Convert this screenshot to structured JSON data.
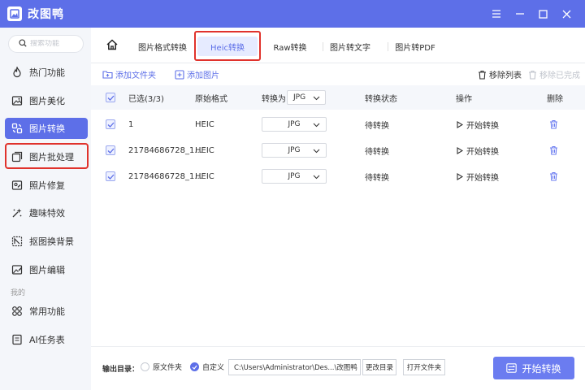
{
  "app": {
    "title": "改图鸭"
  },
  "window": {
    "menu_icon": "menu-icon",
    "minimize_icon": "minimize-icon",
    "maximize_icon": "maximize-icon",
    "close_icon": "close-icon"
  },
  "sidebar": {
    "search_placeholder": "搜索功能",
    "items": [
      {
        "label": "热门功能",
        "icon": "flame-icon"
      },
      {
        "label": "图片美化",
        "icon": "image-icon"
      },
      {
        "label": "图片转换",
        "icon": "convert-icon",
        "active": true
      },
      {
        "label": "图片批处理",
        "icon": "batch-icon"
      },
      {
        "label": "照片修复",
        "icon": "repair-icon"
      },
      {
        "label": "趣味特效",
        "icon": "sparkle-icon"
      },
      {
        "label": "抠图换背景",
        "icon": "cutout-icon"
      },
      {
        "label": "图片编辑",
        "icon": "edit-icon"
      }
    ],
    "section_mine": "我的",
    "mine_items": [
      {
        "label": "常用功能",
        "icon": "grid-icon"
      },
      {
        "label": "AI任务表",
        "icon": "task-icon"
      }
    ]
  },
  "tabs": [
    {
      "label": "图片格式转换"
    },
    {
      "label": "Heic转换",
      "active": true
    },
    {
      "label": "Raw转换"
    },
    {
      "label": "图片转文字"
    },
    {
      "label": "图片转PDF"
    }
  ],
  "toolbar": {
    "add_folder": "添加文件夹",
    "add_image": "添加图片",
    "remove_list": "移除列表",
    "remove_done": "移除已完成"
  },
  "table": {
    "headers": {
      "selected": "已选(3/3)",
      "original_format": "原始格式",
      "convert_to": "转换为",
      "convert_to_value": "JPG",
      "status": "转换状态",
      "operation": "操作",
      "delete": "删除"
    },
    "rows": [
      {
        "name": "1",
        "format": "HEIC",
        "target": "JPG",
        "status": "待转换",
        "action": "开始转换"
      },
      {
        "name": "21784686728_1...",
        "format": "HEIC",
        "target": "JPG",
        "status": "待转换",
        "action": "开始转换"
      },
      {
        "name": "21784686728_1...",
        "format": "HEIC",
        "target": "JPG",
        "status": "待转换",
        "action": "开始转换"
      }
    ]
  },
  "footer": {
    "output_label": "输出目录：",
    "option_original": "原文件夹",
    "option_custom": "自定义",
    "path": "C:\\Users\\Administrator\\Des...\\改图鸭",
    "change_dir": "更改目录",
    "open_folder": "打开文件夹",
    "start_all": "开始转换"
  },
  "colors": {
    "accent": "#5d6fe8",
    "highlight": "#e0322c"
  }
}
